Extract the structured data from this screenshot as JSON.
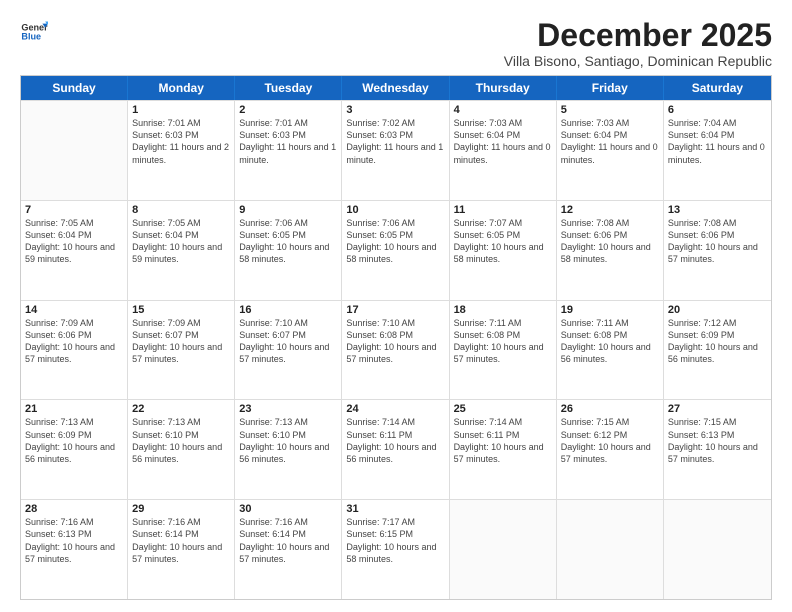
{
  "logo": {
    "line1": "General",
    "line2": "Blue"
  },
  "title": "December 2025",
  "subtitle": "Villa Bisono, Santiago, Dominican Republic",
  "headers": [
    "Sunday",
    "Monday",
    "Tuesday",
    "Wednesday",
    "Thursday",
    "Friday",
    "Saturday"
  ],
  "rows": [
    [
      {
        "day": "",
        "empty": true
      },
      {
        "day": "1",
        "sunrise": "Sunrise: 7:01 AM",
        "sunset": "Sunset: 6:03 PM",
        "daylight": "Daylight: 11 hours and 2 minutes."
      },
      {
        "day": "2",
        "sunrise": "Sunrise: 7:01 AM",
        "sunset": "Sunset: 6:03 PM",
        "daylight": "Daylight: 11 hours and 1 minute."
      },
      {
        "day": "3",
        "sunrise": "Sunrise: 7:02 AM",
        "sunset": "Sunset: 6:03 PM",
        "daylight": "Daylight: 11 hours and 1 minute."
      },
      {
        "day": "4",
        "sunrise": "Sunrise: 7:03 AM",
        "sunset": "Sunset: 6:04 PM",
        "daylight": "Daylight: 11 hours and 0 minutes."
      },
      {
        "day": "5",
        "sunrise": "Sunrise: 7:03 AM",
        "sunset": "Sunset: 6:04 PM",
        "daylight": "Daylight: 11 hours and 0 minutes."
      },
      {
        "day": "6",
        "sunrise": "Sunrise: 7:04 AM",
        "sunset": "Sunset: 6:04 PM",
        "daylight": "Daylight: 11 hours and 0 minutes."
      }
    ],
    [
      {
        "day": "7",
        "sunrise": "Sunrise: 7:05 AM",
        "sunset": "Sunset: 6:04 PM",
        "daylight": "Daylight: 10 hours and 59 minutes."
      },
      {
        "day": "8",
        "sunrise": "Sunrise: 7:05 AM",
        "sunset": "Sunset: 6:04 PM",
        "daylight": "Daylight: 10 hours and 59 minutes."
      },
      {
        "day": "9",
        "sunrise": "Sunrise: 7:06 AM",
        "sunset": "Sunset: 6:05 PM",
        "daylight": "Daylight: 10 hours and 58 minutes."
      },
      {
        "day": "10",
        "sunrise": "Sunrise: 7:06 AM",
        "sunset": "Sunset: 6:05 PM",
        "daylight": "Daylight: 10 hours and 58 minutes."
      },
      {
        "day": "11",
        "sunrise": "Sunrise: 7:07 AM",
        "sunset": "Sunset: 6:05 PM",
        "daylight": "Daylight: 10 hours and 58 minutes."
      },
      {
        "day": "12",
        "sunrise": "Sunrise: 7:08 AM",
        "sunset": "Sunset: 6:06 PM",
        "daylight": "Daylight: 10 hours and 58 minutes."
      },
      {
        "day": "13",
        "sunrise": "Sunrise: 7:08 AM",
        "sunset": "Sunset: 6:06 PM",
        "daylight": "Daylight: 10 hours and 57 minutes."
      }
    ],
    [
      {
        "day": "14",
        "sunrise": "Sunrise: 7:09 AM",
        "sunset": "Sunset: 6:06 PM",
        "daylight": "Daylight: 10 hours and 57 minutes."
      },
      {
        "day": "15",
        "sunrise": "Sunrise: 7:09 AM",
        "sunset": "Sunset: 6:07 PM",
        "daylight": "Daylight: 10 hours and 57 minutes."
      },
      {
        "day": "16",
        "sunrise": "Sunrise: 7:10 AM",
        "sunset": "Sunset: 6:07 PM",
        "daylight": "Daylight: 10 hours and 57 minutes."
      },
      {
        "day": "17",
        "sunrise": "Sunrise: 7:10 AM",
        "sunset": "Sunset: 6:08 PM",
        "daylight": "Daylight: 10 hours and 57 minutes."
      },
      {
        "day": "18",
        "sunrise": "Sunrise: 7:11 AM",
        "sunset": "Sunset: 6:08 PM",
        "daylight": "Daylight: 10 hours and 57 minutes."
      },
      {
        "day": "19",
        "sunrise": "Sunrise: 7:11 AM",
        "sunset": "Sunset: 6:08 PM",
        "daylight": "Daylight: 10 hours and 56 minutes."
      },
      {
        "day": "20",
        "sunrise": "Sunrise: 7:12 AM",
        "sunset": "Sunset: 6:09 PM",
        "daylight": "Daylight: 10 hours and 56 minutes."
      }
    ],
    [
      {
        "day": "21",
        "sunrise": "Sunrise: 7:13 AM",
        "sunset": "Sunset: 6:09 PM",
        "daylight": "Daylight: 10 hours and 56 minutes."
      },
      {
        "day": "22",
        "sunrise": "Sunrise: 7:13 AM",
        "sunset": "Sunset: 6:10 PM",
        "daylight": "Daylight: 10 hours and 56 minutes."
      },
      {
        "day": "23",
        "sunrise": "Sunrise: 7:13 AM",
        "sunset": "Sunset: 6:10 PM",
        "daylight": "Daylight: 10 hours and 56 minutes."
      },
      {
        "day": "24",
        "sunrise": "Sunrise: 7:14 AM",
        "sunset": "Sunset: 6:11 PM",
        "daylight": "Daylight: 10 hours and 56 minutes."
      },
      {
        "day": "25",
        "sunrise": "Sunrise: 7:14 AM",
        "sunset": "Sunset: 6:11 PM",
        "daylight": "Daylight: 10 hours and 57 minutes."
      },
      {
        "day": "26",
        "sunrise": "Sunrise: 7:15 AM",
        "sunset": "Sunset: 6:12 PM",
        "daylight": "Daylight: 10 hours and 57 minutes."
      },
      {
        "day": "27",
        "sunrise": "Sunrise: 7:15 AM",
        "sunset": "Sunset: 6:13 PM",
        "daylight": "Daylight: 10 hours and 57 minutes."
      }
    ],
    [
      {
        "day": "28",
        "sunrise": "Sunrise: 7:16 AM",
        "sunset": "Sunset: 6:13 PM",
        "daylight": "Daylight: 10 hours and 57 minutes."
      },
      {
        "day": "29",
        "sunrise": "Sunrise: 7:16 AM",
        "sunset": "Sunset: 6:14 PM",
        "daylight": "Daylight: 10 hours and 57 minutes."
      },
      {
        "day": "30",
        "sunrise": "Sunrise: 7:16 AM",
        "sunset": "Sunset: 6:14 PM",
        "daylight": "Daylight: 10 hours and 57 minutes."
      },
      {
        "day": "31",
        "sunrise": "Sunrise: 7:17 AM",
        "sunset": "Sunset: 6:15 PM",
        "daylight": "Daylight: 10 hours and 58 minutes."
      },
      {
        "day": "",
        "empty": true
      },
      {
        "day": "",
        "empty": true
      },
      {
        "day": "",
        "empty": true
      }
    ]
  ]
}
